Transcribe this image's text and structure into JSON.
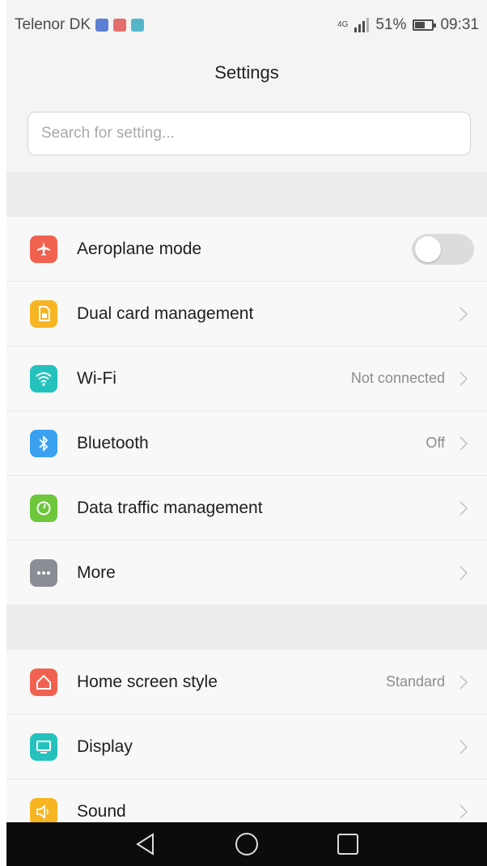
{
  "status_bar": {
    "carrier": "Telenor DK",
    "network_type": "4G",
    "battery_percent": "51%",
    "time": "09:31",
    "notification_icons": [
      "photo-icon",
      "app-icon",
      "gallery-icon"
    ]
  },
  "header": {
    "title": "Settings"
  },
  "search": {
    "placeholder": "Search for setting..."
  },
  "group1": [
    {
      "label": "Aeroplane mode",
      "icon": "aeroplane-icon",
      "color": "#f1614f",
      "toggle": false
    },
    {
      "label": "Dual card management",
      "icon": "sim-card-icon",
      "color": "#f7b524"
    },
    {
      "label": "Wi-Fi",
      "icon": "wifi-icon",
      "color": "#25c2bd",
      "value": "Not connected"
    },
    {
      "label": "Bluetooth",
      "icon": "bluetooth-icon",
      "color": "#3aa0f0",
      "value": "Off"
    },
    {
      "label": "Data traffic management",
      "icon": "data-traffic-icon",
      "color": "#6dc63b"
    },
    {
      "label": "More",
      "icon": "more-icon",
      "color": "#8b8d94"
    }
  ],
  "group2": [
    {
      "label": "Home screen style",
      "icon": "home-icon",
      "color": "#f1614f",
      "value": "Standard"
    },
    {
      "label": "Display",
      "icon": "display-icon",
      "color": "#25c2bd"
    },
    {
      "label": "Sound",
      "icon": "sound-icon",
      "color": "#f7b524"
    }
  ],
  "nav_bar": [
    "back-icon",
    "home-nav-icon",
    "recents-icon"
  ]
}
